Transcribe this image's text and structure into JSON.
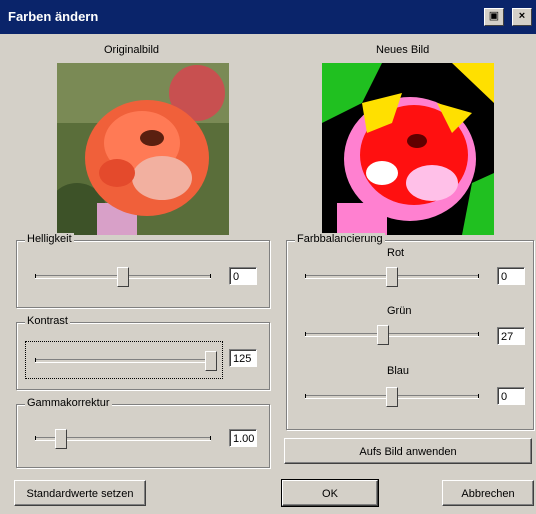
{
  "window": {
    "title": "Farben ändern",
    "close_glyph": "×",
    "icon": "restore-image-icon"
  },
  "images": {
    "original_label": "Originalbild",
    "new_label": "Neues Bild"
  },
  "brightness": {
    "label": "Helligkeit",
    "value": "0",
    "level": 0.5
  },
  "contrast": {
    "label": "Kontrast",
    "value": "125",
    "level": 1.0
  },
  "gamma": {
    "label": "Gammakorrektur",
    "value": "1.00",
    "level": 0.15
  },
  "color_balance": {
    "label": "Farbbalancierung",
    "channels": [
      {
        "label": "Rot",
        "value": "0",
        "level": 0.5
      },
      {
        "label": "Grün",
        "value": "27",
        "level": 0.45
      },
      {
        "label": "Blau",
        "value": "0",
        "level": 0.5
      }
    ]
  },
  "buttons": {
    "apply": "Aufs Bild anwenden",
    "defaults": "Standardwerte setzen",
    "ok": "OK",
    "cancel": "Abbrechen"
  }
}
